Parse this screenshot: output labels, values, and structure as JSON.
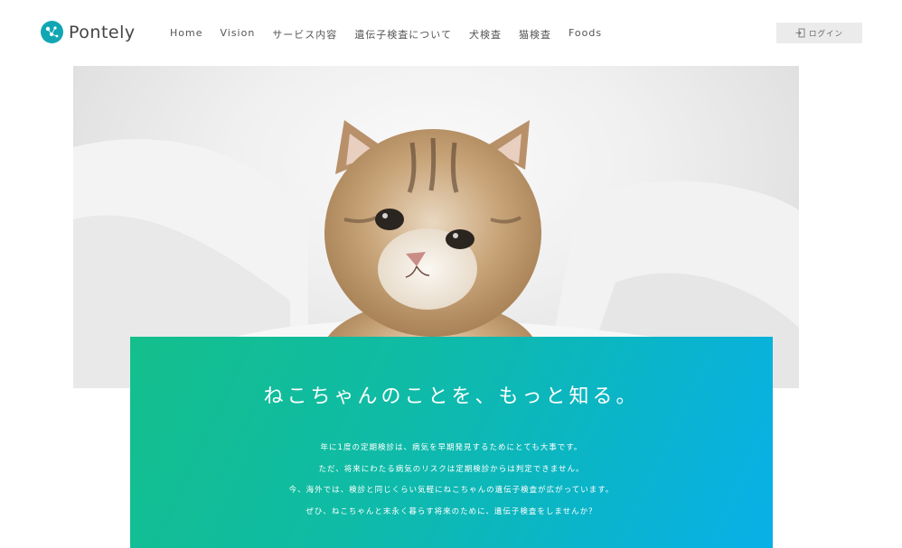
{
  "header": {
    "logo_text": "Pontely",
    "nav": [
      "Home",
      "Vision",
      "サービス内容",
      "遺伝子検査について",
      "犬検査",
      "猫検査",
      "Foods"
    ],
    "login_label": "ログイン"
  },
  "hero": {
    "image_subject": "kitten-photo"
  },
  "intro": {
    "title": "ねこちゃんのことを、もっと知る。",
    "lines": [
      "年に1度の定期検診は、病気を早期発見するためにとても大事です。",
      "ただ、将来にわたる病気のリスクは定期検診からは判定できません。",
      "今、海外では、検診と同じくらい気軽にねこちゃんの遺伝子検査が広がっています。",
      "ぜひ、ねこちゃんと末永く暮らす将来のために、遺伝子検査をしませんか？"
    ]
  },
  "colors": {
    "brand": "#11a6b4",
    "gradient_start": "#14bf8c",
    "gradient_end": "#08b0e8"
  }
}
